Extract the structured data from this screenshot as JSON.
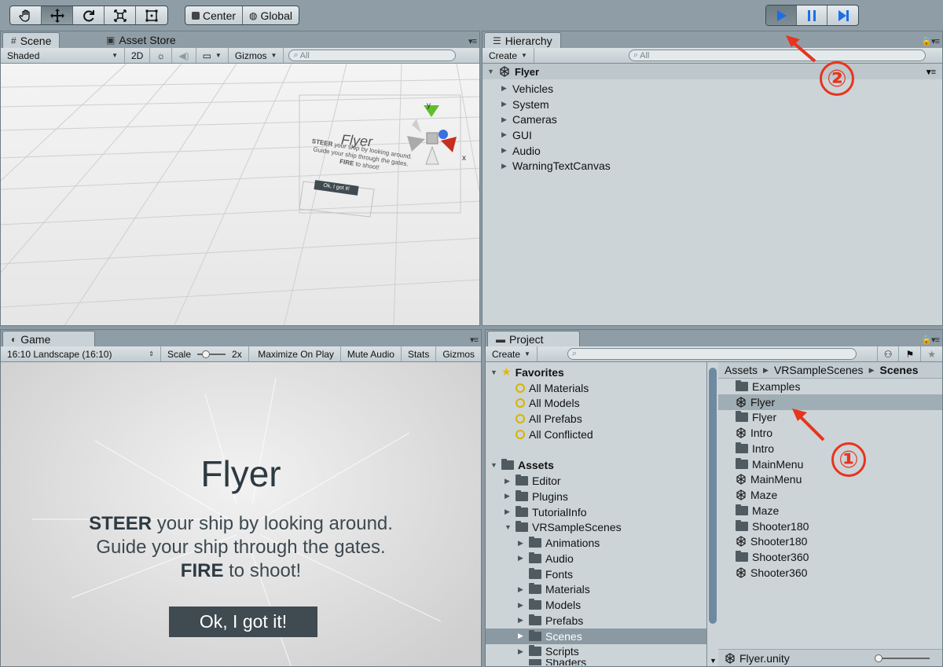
{
  "toolbar": {
    "tools": [
      "hand-icon",
      "move-icon",
      "rotate-icon",
      "scale-icon",
      "rect-icon"
    ],
    "pivot_label": "Center",
    "space_label": "Global",
    "play": [
      "play-icon",
      "pause-icon",
      "step-icon"
    ]
  },
  "scene": {
    "tab_label": "Scene",
    "tab2_label": "Asset Store",
    "shading": "Shaded",
    "mode_2d": "2D",
    "gizmos": "Gizmos",
    "search_placeholder": "All",
    "canvas_title": "Flyer",
    "canvas_line1_bold": "STEER",
    "canvas_line1": " your ship by looking around.",
    "canvas_line2": "Guide your ship through the gates.",
    "canvas_line3_bold": "FIRE",
    "canvas_line3": " to shoot!",
    "canvas_button": "Ok, I got it!",
    "axis_y": "y",
    "axis_x": "x"
  },
  "hierarchy": {
    "tab_label": "Hierarchy",
    "create_label": "Create",
    "search_placeholder": "All",
    "root": "Flyer",
    "items": [
      "Vehicles",
      "System",
      "Cameras",
      "GUI",
      "Audio",
      "WarningTextCanvas"
    ]
  },
  "game": {
    "tab_label": "Game",
    "aspect": "16:10 Landscape (16:10)",
    "scale_label": "Scale",
    "scale_value": "2x",
    "maximize": "Maximize On Play",
    "mute": "Mute Audio",
    "stats": "Stats",
    "gizmos": "Gizmos",
    "title": "Flyer",
    "line1_bold": "STEER",
    "line1": " your ship by looking around.",
    "line2": "Guide your ship through the gates.",
    "line3_bold": "FIRE",
    "line3": " to shoot!",
    "button": "Ok, I got it!"
  },
  "project": {
    "tab_label": "Project",
    "create_label": "Create",
    "favorites_label": "Favorites",
    "favorites": [
      "All Materials",
      "All Models",
      "All Prefabs",
      "All Conflicted"
    ],
    "assets_label": "Assets",
    "assets_children": [
      "Editor",
      "Plugins",
      "TutorialInfo",
      "VRSampleScenes"
    ],
    "vr_children": [
      "Animations",
      "Audio",
      "Fonts",
      "Materials",
      "Models",
      "Prefabs",
      "Scenes",
      "Scripts",
      "Shaders"
    ],
    "breadcrumb": [
      "Assets",
      "VRSampleScenes",
      "Scenes"
    ],
    "files": [
      {
        "name": "Examples",
        "type": "folder"
      },
      {
        "name": "Flyer",
        "type": "scene"
      },
      {
        "name": "Flyer",
        "type": "folder"
      },
      {
        "name": "Intro",
        "type": "scene"
      },
      {
        "name": "Intro",
        "type": "folder"
      },
      {
        "name": "MainMenu",
        "type": "folder"
      },
      {
        "name": "MainMenu",
        "type": "scene"
      },
      {
        "name": "Maze",
        "type": "scene"
      },
      {
        "name": "Maze",
        "type": "folder"
      },
      {
        "name": "Shooter180",
        "type": "folder"
      },
      {
        "name": "Shooter180",
        "type": "scene"
      },
      {
        "name": "Shooter360",
        "type": "folder"
      },
      {
        "name": "Shooter360",
        "type": "scene"
      }
    ],
    "selected_file": "Flyer.unity"
  },
  "annotations": {
    "one": "①",
    "two": "②",
    "color": "#e8341c"
  }
}
